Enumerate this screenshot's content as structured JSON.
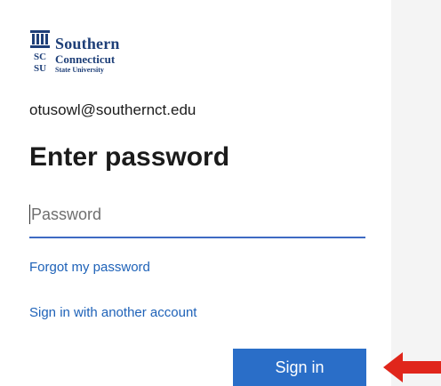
{
  "logo": {
    "line1": "Southern",
    "line2": "Connecticut",
    "line3": "State University",
    "monogram_top": "SC",
    "monogram_bottom": "SU"
  },
  "account": {
    "email": "otusowl@southernct.edu"
  },
  "title": "Enter password",
  "password_field": {
    "placeholder": "Password",
    "value": ""
  },
  "links": {
    "forgot": "Forgot my password",
    "other_account": "Sign in with another account"
  },
  "sign_in_button": {
    "label": "Sign in"
  },
  "colors": {
    "brand": "#1e3f78",
    "accent": "#2a6ec8",
    "link": "#1e62b8",
    "annotation_arrow": "#e0261b"
  },
  "icons": {
    "annotation": "arrow-left-icon"
  }
}
